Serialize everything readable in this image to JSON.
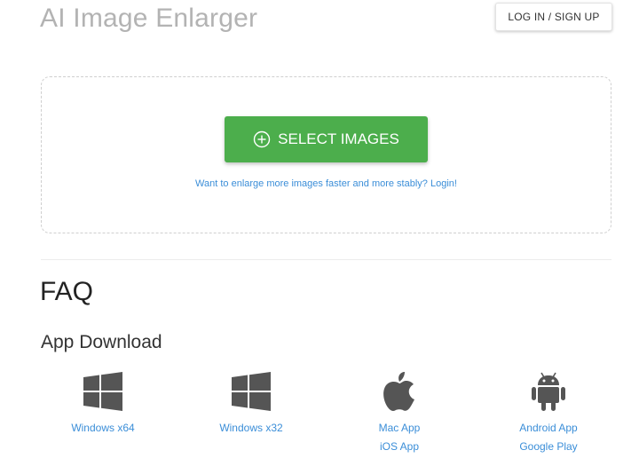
{
  "header": {
    "title": "AI Image Enlarger",
    "login_label": "LOG IN / SIGN UP"
  },
  "upload": {
    "select_label": "SELECT IMAGES",
    "select_icon": "plus-circle-icon",
    "hint": "Want to enlarge more images faster and more stably? Login!"
  },
  "faq": {
    "heading": "FAQ"
  },
  "app_download": {
    "heading": "App Download",
    "items": [
      {
        "icon": "windows-icon",
        "links": [
          "Windows x64"
        ]
      },
      {
        "icon": "windows-icon",
        "links": [
          "Windows x32"
        ]
      },
      {
        "icon": "apple-icon",
        "links": [
          "Mac App",
          "iOS App"
        ]
      },
      {
        "icon": "android-icon",
        "links": [
          "Android App",
          "Google Play"
        ]
      }
    ]
  },
  "colors": {
    "accent_green": "#4cae4c",
    "link_blue": "#3b8ed8",
    "icon_gray": "#555555"
  }
}
